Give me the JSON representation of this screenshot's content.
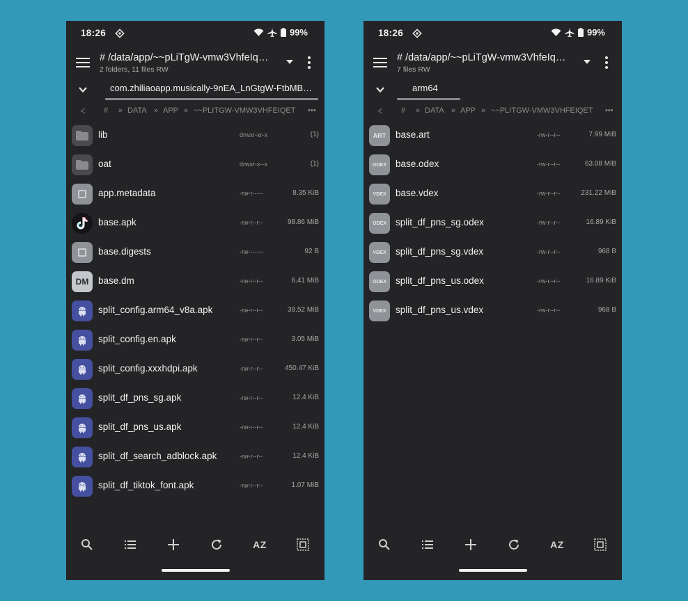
{
  "status": {
    "time": "18:26",
    "battery": "99%"
  },
  "left": {
    "path": "# /data/app/~~pLiTgW-vmw3VhfeIqEt…",
    "counts": "2 folders, 11 files RW",
    "tab": "com.zhiliaoapp.musically-9nEA_LnGtgW-FtbMB…",
    "crumbs": [
      "#",
      "»",
      "DATA",
      "»",
      "APP",
      "»",
      "~~PLITGW-VMW3VHFEIQET",
      "•••"
    ],
    "files": [
      {
        "icon": "folder-icon",
        "name": "lib",
        "perm": "drwxr-xr-x",
        "size": "(1)"
      },
      {
        "icon": "folder-icon",
        "name": "oat",
        "perm": "drwxr-x--x",
        "size": "(1)"
      },
      {
        "icon": "generic-file-icon",
        "name": "app.metadata",
        "perm": "-rw-r-----",
        "size": "8.35 KiB"
      },
      {
        "icon": "tiktok-icon",
        "name": "base.apk",
        "perm": "-rw-r--r--",
        "size": "98.86 MiB"
      },
      {
        "icon": "generic-file-icon",
        "name": "base.digests",
        "perm": "-rw-------",
        "size": "92 B"
      },
      {
        "icon": "dm-file-icon",
        "label": "DM",
        "name": "base.dm",
        "perm": "-rw-r--r--",
        "size": "6.41 MiB"
      },
      {
        "icon": "android-icon",
        "name": "split_config.arm64_v8a.apk",
        "perm": "-rw-r--r--",
        "size": "39.52 MiB"
      },
      {
        "icon": "android-icon",
        "name": "split_config.en.apk",
        "perm": "-rw-r--r--",
        "size": "3.05 MiB"
      },
      {
        "icon": "android-icon",
        "name": "split_config.xxxhdpi.apk",
        "perm": "-rw-r--r--",
        "size": "450.47 KiB"
      },
      {
        "icon": "android-icon",
        "name": "split_df_pns_sg.apk",
        "perm": "-rw-r--r--",
        "size": "12.4 KiB"
      },
      {
        "icon": "android-icon",
        "name": "split_df_pns_us.apk",
        "perm": "-rw-r--r--",
        "size": "12.4 KiB"
      },
      {
        "icon": "android-icon",
        "name": "split_df_search_adblock.apk",
        "perm": "-rw-r--r--",
        "size": "12.4 KiB"
      },
      {
        "icon": "android-icon",
        "name": "split_df_tiktok_font.apk",
        "perm": "-rw-r--r--",
        "size": "1.07 MiB"
      }
    ]
  },
  "right": {
    "path": "# /data/app/~~pLiTgW-vmw3VhfeIqEt…",
    "counts": "7 files RW",
    "tab": "arm64",
    "crumbs": [
      "#",
      "»",
      "DATA",
      "»",
      "APP",
      "»",
      "~~PLITGW-VMW3VHFEIQET",
      "•••"
    ],
    "files": [
      {
        "icon": "art-file-icon",
        "label": "ART",
        "name": "base.art",
        "perm": "-rw-r--r--",
        "size": "7.99 MiB"
      },
      {
        "icon": "odex-file-icon",
        "label": "ODEX",
        "name": "base.odex",
        "perm": "-rw-r--r--",
        "size": "63.08 MiB"
      },
      {
        "icon": "vdex-file-icon",
        "label": "VDEX",
        "name": "base.vdex",
        "perm": "-rw-r--r--",
        "size": "231.22 MiB"
      },
      {
        "icon": "odex-file-icon",
        "label": "ODEX",
        "name": "split_df_pns_sg.odex",
        "perm": "-rw-r--r--",
        "size": "16.89 KiB"
      },
      {
        "icon": "vdex-file-icon",
        "label": "VDEX",
        "name": "split_df_pns_sg.vdex",
        "perm": "-rw-r--r--",
        "size": "968 B"
      },
      {
        "icon": "odex-file-icon",
        "label": "ODEX",
        "name": "split_df_pns_us.odex",
        "perm": "-rw-r--r--",
        "size": "16.89 KiB"
      },
      {
        "icon": "vdex-file-icon",
        "label": "VDEX",
        "name": "split_df_pns_us.vdex",
        "perm": "-rw-r--r--",
        "size": "968 B"
      }
    ]
  },
  "bottom": {
    "sort_label": "AZ"
  },
  "colors": {
    "background": "#3399b8",
    "panel": "#242426",
    "android_badge": "#4550a0"
  }
}
